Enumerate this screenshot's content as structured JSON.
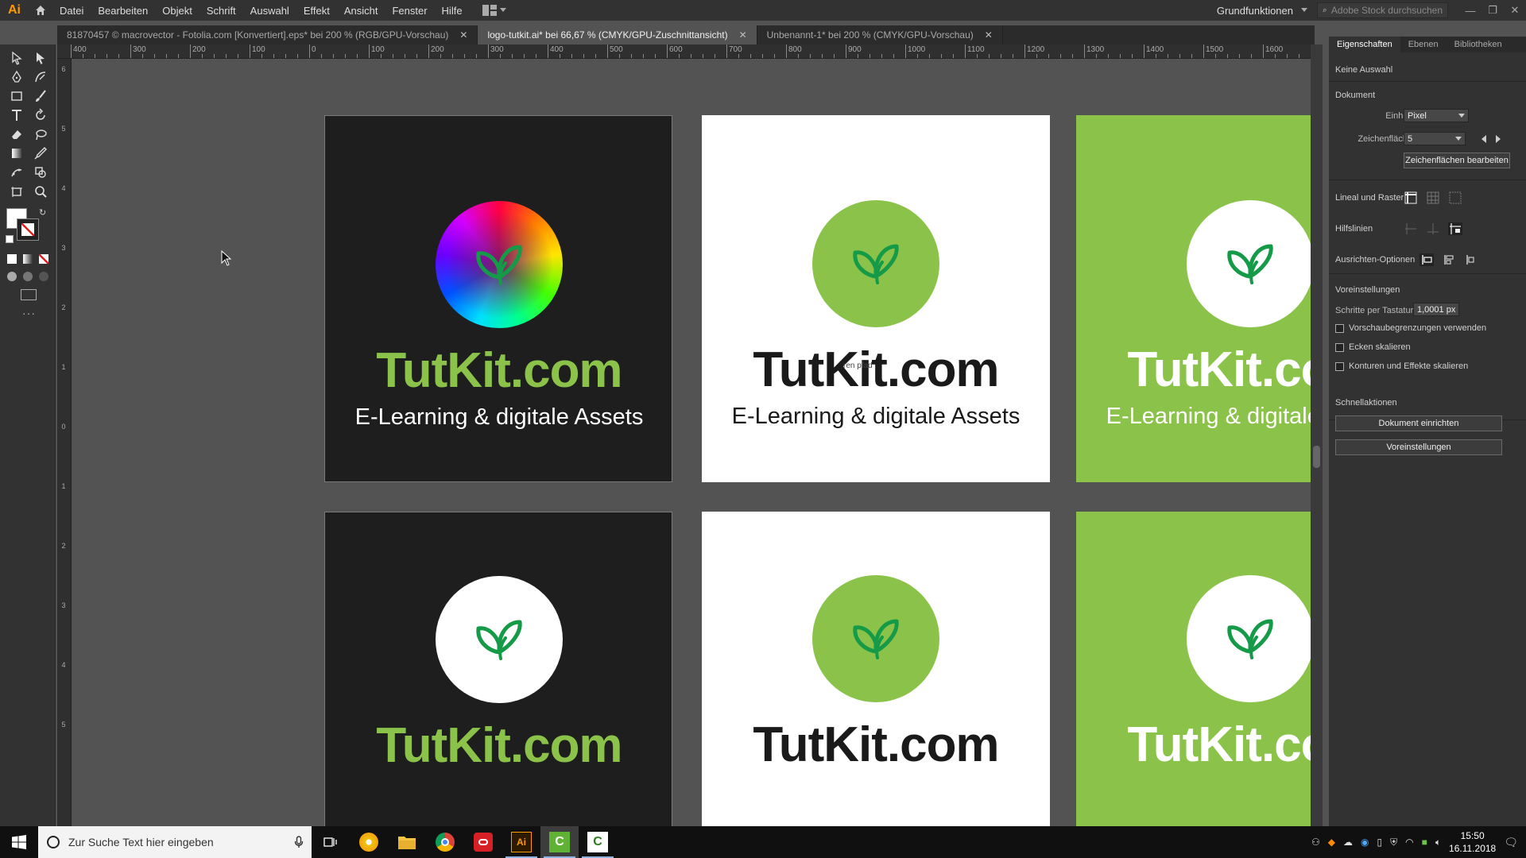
{
  "app": {
    "logo": "Ai"
  },
  "menu": {
    "items": [
      "Datei",
      "Bearbeiten",
      "Objekt",
      "Schrift",
      "Auswahl",
      "Effekt",
      "Ansicht",
      "Fenster",
      "Hilfe"
    ]
  },
  "workspace": {
    "label": "Grundfunktionen"
  },
  "stock_search": {
    "placeholder": "Adobe Stock durchsuchen"
  },
  "window_controls": {
    "minimize": "—",
    "restore": "❐",
    "close": "✕"
  },
  "tabs": [
    {
      "label": "81870457 © macrovector - Fotolia.com [Konvertiert].eps* bei 200 % (RGB/GPU-Vorschau)",
      "close": "✕"
    },
    {
      "label": "logo-tutkit.ai* bei 66,67 % (CMYK/GPU-Zuschnittansicht)",
      "close": "✕"
    },
    {
      "label": "Unbenannt-1* bei 200 % (CMYK/GPU-Vorschau)",
      "close": "✕"
    }
  ],
  "ruler_h": [
    "400",
    "300",
    "200",
    "100",
    "0",
    "100",
    "200",
    "300",
    "400",
    "500",
    "600",
    "700",
    "800",
    "900",
    "1000",
    "1100",
    "1200",
    "1300",
    "1400",
    "1500",
    "1600"
  ],
  "ruler_v": [
    "6",
    "5",
    "4",
    "3",
    "2",
    "1",
    "0",
    "1",
    "2",
    "3",
    "4",
    "5"
  ],
  "artboards": {
    "brand": "TutKit.com",
    "tagline": "E-Learning & digitale Assets",
    "overlap_fragment": "ren pfad"
  },
  "colors": {
    "brand_green": "#8bc34a",
    "logo_green": "#159a48",
    "dark_bg": "#1e1e1e",
    "accent": "#ff9a00"
  },
  "panel": {
    "tabs": [
      "Eigenschaften",
      "Ebenen",
      "Bibliotheken"
    ],
    "no_selection": "Keine Auswahl",
    "document": "Dokument",
    "unit_label": "Einheit:",
    "unit_value": "Pixel",
    "artboard_label": "Zeichenfläche:",
    "artboard_value": "5",
    "edit_artboards": "Zeichenflächen bearbeiten",
    "rulers_grids": "Lineal und Raster",
    "guides": "Hilfslinien",
    "align_options": "Ausrichten-Optionen",
    "preferences_header": "Voreinstellungen",
    "keyboard_increment_label": "Schritte per Tastatur:",
    "keyboard_increment_value": "1,0001 px",
    "checkboxes": [
      "Vorschaubegrenzungen verwenden",
      "Ecken skalieren",
      "Konturen und Effekte skalieren"
    ],
    "quick_actions": "Schnellaktionen",
    "doc_setup_button": "Dokument einrichten",
    "preferences_button": "Voreinstellungen"
  },
  "taskbar": {
    "search_placeholder": "Zur Suche Text hier eingeben",
    "time": "15:50",
    "date": "16.11.2018"
  }
}
